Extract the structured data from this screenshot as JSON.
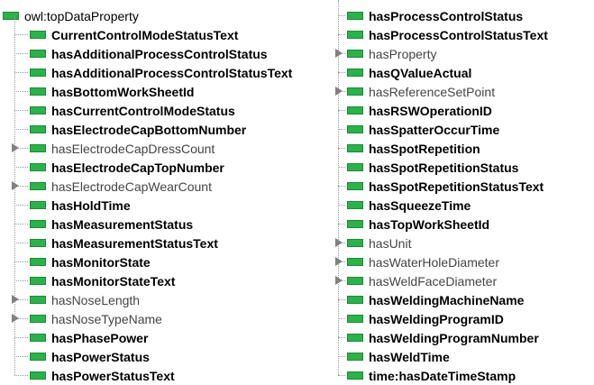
{
  "root": {
    "label": "owl:topDataProperty"
  },
  "columns": [
    [
      {
        "label": "CurrentControlModeStatusText",
        "bold": true,
        "expandable": false
      },
      {
        "label": "hasAdditionalProcessControlStatus",
        "bold": true,
        "expandable": false
      },
      {
        "label": "hasAdditionalProcessControlStatusText",
        "bold": true,
        "expandable": false
      },
      {
        "label": "hasBottomWorkSheetId",
        "bold": true,
        "expandable": false
      },
      {
        "label": "hasCurrentControlModeStatus",
        "bold": true,
        "expandable": false
      },
      {
        "label": "hasElectrodeCapBottomNumber",
        "bold": true,
        "expandable": false
      },
      {
        "label": "hasElectrodeCapDressCount",
        "bold": false,
        "expandable": true
      },
      {
        "label": "hasElectrodeCapTopNumber",
        "bold": true,
        "expandable": false
      },
      {
        "label": "hasElectrodeCapWearCount",
        "bold": false,
        "expandable": true
      },
      {
        "label": "hasHoldTime",
        "bold": true,
        "expandable": false
      },
      {
        "label": "hasMeasurementStatus",
        "bold": true,
        "expandable": false
      },
      {
        "label": "hasMeasurementStatusText",
        "bold": true,
        "expandable": false
      },
      {
        "label": "hasMonitorState",
        "bold": true,
        "expandable": false
      },
      {
        "label": "hasMonitorStateText",
        "bold": true,
        "expandable": false
      },
      {
        "label": "hasNoseLength",
        "bold": false,
        "expandable": true
      },
      {
        "label": "hasNoseTypeName",
        "bold": false,
        "expandable": true
      },
      {
        "label": "hasPhasePower",
        "bold": true,
        "expandable": false
      },
      {
        "label": "hasPowerStatus",
        "bold": true,
        "expandable": false
      },
      {
        "label": "hasPowerStatusText",
        "bold": true,
        "expandable": false
      }
    ],
    [
      {
        "label": "hasProcessControlStatus",
        "bold": true,
        "expandable": false
      },
      {
        "label": "hasProcessControlStatusText",
        "bold": true,
        "expandable": false
      },
      {
        "label": "hasProperty",
        "bold": false,
        "expandable": true
      },
      {
        "label": "hasQValueActual",
        "bold": true,
        "expandable": false
      },
      {
        "label": "hasReferenceSetPoint",
        "bold": false,
        "expandable": true
      },
      {
        "label": "hasRSWOperationID",
        "bold": true,
        "expandable": false
      },
      {
        "label": "hasSpatterOccurTime",
        "bold": true,
        "expandable": false
      },
      {
        "label": "hasSpotRepetition",
        "bold": true,
        "expandable": false
      },
      {
        "label": "hasSpotRepetitionStatus",
        "bold": true,
        "expandable": false
      },
      {
        "label": "hasSpotRepetitionStatusText",
        "bold": true,
        "expandable": false
      },
      {
        "label": "hasSqueezeTime",
        "bold": true,
        "expandable": false
      },
      {
        "label": "hasTopWorkSheetId",
        "bold": true,
        "expandable": false
      },
      {
        "label": "hasUnit",
        "bold": false,
        "expandable": true
      },
      {
        "label": "hasWaterHoleDiameter",
        "bold": false,
        "expandable": true
      },
      {
        "label": "hasWeldFaceDiameter",
        "bold": false,
        "expandable": true
      },
      {
        "label": "hasWeldingMachineName",
        "bold": true,
        "expandable": false
      },
      {
        "label": "hasWeldingProgramID",
        "bold": true,
        "expandable": false
      },
      {
        "label": "hasWeldingProgramNumber",
        "bold": true,
        "expandable": false
      },
      {
        "label": "hasWeldTime",
        "bold": true,
        "expandable": false
      },
      {
        "label": "time:hasDateTimeStamp",
        "bold": true,
        "expandable": false
      }
    ]
  ],
  "colors": {
    "icon_fill": "#2bb24a",
    "icon_border": "#1e8a36",
    "expander": "#808080",
    "connector": "#9a9a9a"
  },
  "icons": {
    "property": "green-bar-icon",
    "expander": "triangle-right-icon"
  }
}
